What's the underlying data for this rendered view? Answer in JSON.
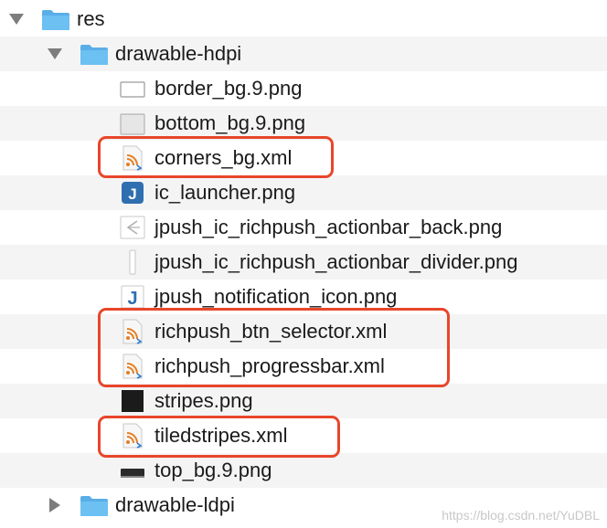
{
  "tree": {
    "res": {
      "label": "res",
      "expanded": true
    },
    "hdpi": {
      "label": "drawable-hdpi",
      "expanded": true
    },
    "files": [
      {
        "label": "border_bg.9.png",
        "icon": "white-image-icon",
        "highlighted": false
      },
      {
        "label": "bottom_bg.9.png",
        "icon": "gray-image-icon",
        "highlighted": false
      },
      {
        "label": "corners_bg.xml",
        "icon": "xml-file-icon",
        "highlighted": true
      },
      {
        "label": "ic_launcher.png",
        "icon": "launcher-j-icon",
        "highlighted": false
      },
      {
        "label": "jpush_ic_richpush_actionbar_back.png",
        "icon": "back-arrow-image-icon",
        "highlighted": false
      },
      {
        "label": "jpush_ic_richpush_actionbar_divider.png",
        "icon": "divider-image-icon",
        "highlighted": false
      },
      {
        "label": "jpush_notification_icon.png",
        "icon": "notification-j-icon",
        "highlighted": false
      },
      {
        "label": "richpush_btn_selector.xml",
        "icon": "xml-file-icon",
        "highlighted": true
      },
      {
        "label": "richpush_progressbar.xml",
        "icon": "xml-file-icon",
        "highlighted": true
      },
      {
        "label": "stripes.png",
        "icon": "black-image-icon",
        "highlighted": false
      },
      {
        "label": "tiledstripes.xml",
        "icon": "xml-file-icon",
        "highlighted": true
      },
      {
        "label": "top_bg.9.png",
        "icon": "dark-bar-image-icon",
        "highlighted": false
      }
    ],
    "ldpi": {
      "label": "drawable-ldpi",
      "expanded": false
    }
  },
  "watermark": "https://blog.csdn.net/YuDBL",
  "colors": {
    "folder": "#5aaee8",
    "highlight": "#e8462a",
    "alt_row": "#f4f4f5"
  }
}
